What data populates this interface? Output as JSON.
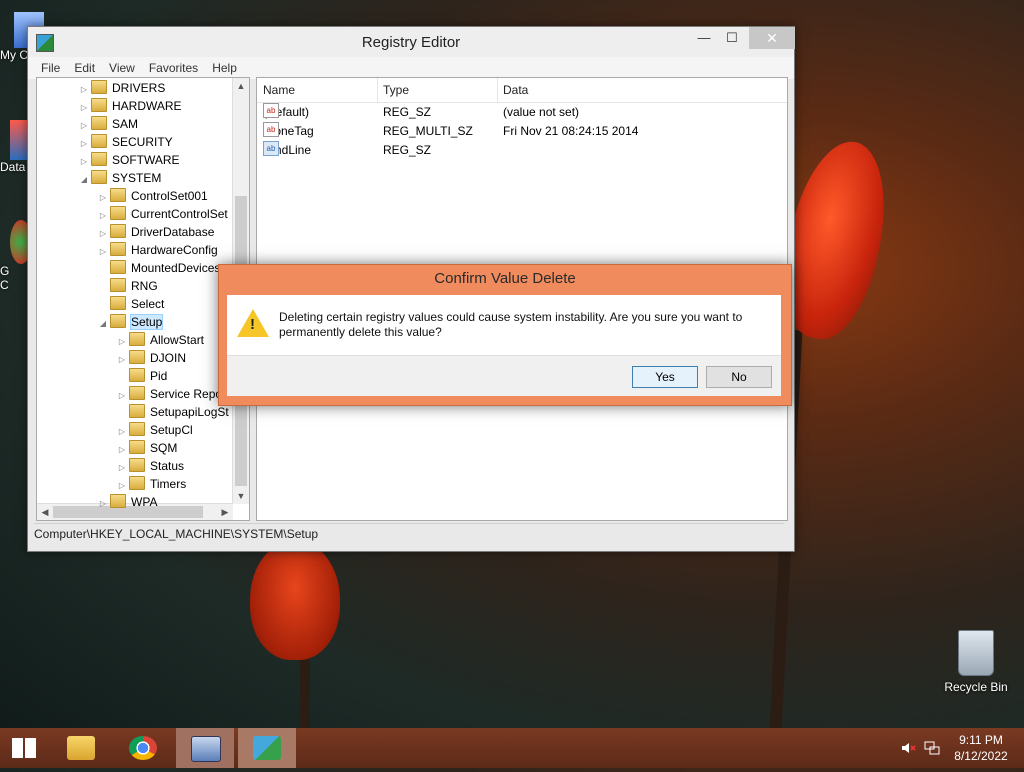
{
  "desktop": {
    "left_icons": [
      "My C",
      "Data",
      "G\nC"
    ],
    "recycle_bin_label": "Recycle Bin"
  },
  "window": {
    "title": "Registry Editor",
    "controls": {
      "minimize": "—",
      "maximize": "☐",
      "close": "✕"
    },
    "menu": [
      "File",
      "Edit",
      "View",
      "Favorites",
      "Help"
    ],
    "tree": [
      {
        "label": "DRIVERS",
        "depth": 1,
        "expander": "▷"
      },
      {
        "label": "HARDWARE",
        "depth": 1,
        "expander": "▷"
      },
      {
        "label": "SAM",
        "depth": 1,
        "expander": "▷"
      },
      {
        "label": "SECURITY",
        "depth": 1,
        "expander": "▷"
      },
      {
        "label": "SOFTWARE",
        "depth": 1,
        "expander": "▷"
      },
      {
        "label": "SYSTEM",
        "depth": 1,
        "expander": "◢"
      },
      {
        "label": "ControlSet001",
        "depth": 2,
        "expander": "▷"
      },
      {
        "label": "CurrentControlSet",
        "depth": 2,
        "expander": "▷"
      },
      {
        "label": "DriverDatabase",
        "depth": 2,
        "expander": "▷"
      },
      {
        "label": "HardwareConfig",
        "depth": 2,
        "expander": "▷"
      },
      {
        "label": "MountedDevices",
        "depth": 2,
        "expander": ""
      },
      {
        "label": "RNG",
        "depth": 2,
        "expander": ""
      },
      {
        "label": "Select",
        "depth": 2,
        "expander": ""
      },
      {
        "label": "Setup",
        "depth": 2,
        "expander": "◢",
        "selected": true
      },
      {
        "label": "AllowStart",
        "depth": 3,
        "expander": "▷"
      },
      {
        "label": "DJOIN",
        "depth": 3,
        "expander": "▷"
      },
      {
        "label": "Pid",
        "depth": 3,
        "expander": ""
      },
      {
        "label": "Service Repo",
        "depth": 3,
        "expander": "▷"
      },
      {
        "label": "SetupapiLogSt",
        "depth": 3,
        "expander": ""
      },
      {
        "label": "SetupCl",
        "depth": 3,
        "expander": "▷"
      },
      {
        "label": "SQM",
        "depth": 3,
        "expander": "▷"
      },
      {
        "label": "Status",
        "depth": 3,
        "expander": "▷"
      },
      {
        "label": "Timers",
        "depth": 3,
        "expander": "▷"
      },
      {
        "label": "WPA",
        "depth": 2,
        "expander": "▷"
      }
    ],
    "list": {
      "columns": [
        "Name",
        "Type",
        "Data"
      ],
      "rows": [
        {
          "icon": "ab",
          "icon_color": "red",
          "name": "(Default)",
          "type": "REG_SZ",
          "data": "(value not set)"
        },
        {
          "icon": "ab",
          "icon_color": "red",
          "name": "CloneTag",
          "type": "REG_MULTI_SZ",
          "data": "Fri Nov 21 08:24:15 2014"
        },
        {
          "icon": "ab",
          "icon_color": "blue",
          "name": "CmdLine",
          "type": "REG_SZ",
          "data": ""
        }
      ]
    },
    "status_path": "Computer\\HKEY_LOCAL_MACHINE\\SYSTEM\\Setup"
  },
  "dialog": {
    "title": "Confirm Value Delete",
    "message": "Deleting certain registry values could cause system instability. Are you sure you want to permanently delete this value?",
    "yes_label": "Yes",
    "no_label": "No",
    "warning_glyph": "!"
  },
  "taskbar": {
    "apps": [
      "start-icon",
      "file-explorer-icon",
      "chrome-icon",
      "performance-monitor-icon",
      "registry-editor-icon"
    ],
    "clock_time": "9:11 PM",
    "clock_date": "8/12/2022"
  },
  "colors": {
    "dialog_frame": "#f08b5e",
    "taskbar": "#6a321e",
    "selection": "#cde8ff"
  }
}
